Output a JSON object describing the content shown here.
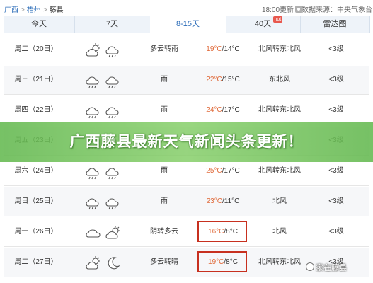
{
  "breadcrumb": {
    "province": "广西",
    "city": "梧州",
    "county": "藤县",
    "separator": ">"
  },
  "update_info": {
    "time": "18:00更新"
  },
  "source_info": {
    "text": "数据来源：中央气象台"
  },
  "tabs": [
    {
      "label": "今天",
      "active": false
    },
    {
      "label": "7天",
      "active": false
    },
    {
      "label": "8-15天",
      "active": true
    },
    {
      "label": "40天",
      "active": false,
      "badge": "hot"
    },
    {
      "label": "雷达图",
      "active": false
    }
  ],
  "forecast": [
    {
      "day": "周二（20日）",
      "icons": [
        "partly-cloudy-icon",
        "rain-icon"
      ],
      "condition": "多云转雨",
      "high": "19°C",
      "low": "/14°C",
      "wind": "北风转东北风",
      "level": "<3级",
      "highlight": false
    },
    {
      "day": "周三（21日）",
      "icons": [
        "rain-icon",
        "rain-icon"
      ],
      "condition": "雨",
      "high": "22°C",
      "low": "/15°C",
      "wind": "东北风",
      "level": "<3级",
      "highlight": false
    },
    {
      "day": "周四（22日）",
      "icons": [
        "rain-icon",
        "rain-icon"
      ],
      "condition": "雨",
      "high": "24°C",
      "low": "/17°C",
      "wind": "北风转东北风",
      "level": "<3级",
      "highlight": false
    },
    {
      "day": "周五（23日）",
      "icons": [
        "rain-icon",
        "rain-icon"
      ],
      "condition": "雨",
      "high": "",
      "low": "",
      "wind": "",
      "level": "<3级",
      "highlight": false
    },
    {
      "day": "周六（24日）",
      "icons": [
        "rain-icon",
        "rain-icon"
      ],
      "condition": "雨",
      "high": "25°C",
      "low": "/17°C",
      "wind": "北风转东北风",
      "level": "<3级",
      "highlight": false
    },
    {
      "day": "周日（25日）",
      "icons": [
        "rain-icon",
        "rain-icon"
      ],
      "condition": "雨",
      "high": "23°C",
      "low": "/11°C",
      "wind": "北风",
      "level": "<3级",
      "highlight": false
    },
    {
      "day": "周一（26日）",
      "icons": [
        "cloudy-icon",
        "partly-cloudy-icon"
      ],
      "condition": "阴转多云",
      "high": "16°C",
      "low": "/8°C",
      "wind": "北风",
      "level": "<3级",
      "highlight": true
    },
    {
      "day": "周二（27日）",
      "icons": [
        "partly-cloudy-icon",
        "moon-icon"
      ],
      "condition": "多云转晴",
      "high": "19°C",
      "low": "/8°C",
      "wind": "北风转东北风",
      "level": "<3级",
      "highlight": true
    }
  ],
  "banner": {
    "title": "广西藤县最新天气新闻头条更新！"
  },
  "watermark": {
    "text": "家在藤县"
  },
  "colors": {
    "link": "#2b6cb8",
    "high_temp": "#e06a3a",
    "highlight_border": "#c7301f",
    "banner": "#6cbf55"
  }
}
